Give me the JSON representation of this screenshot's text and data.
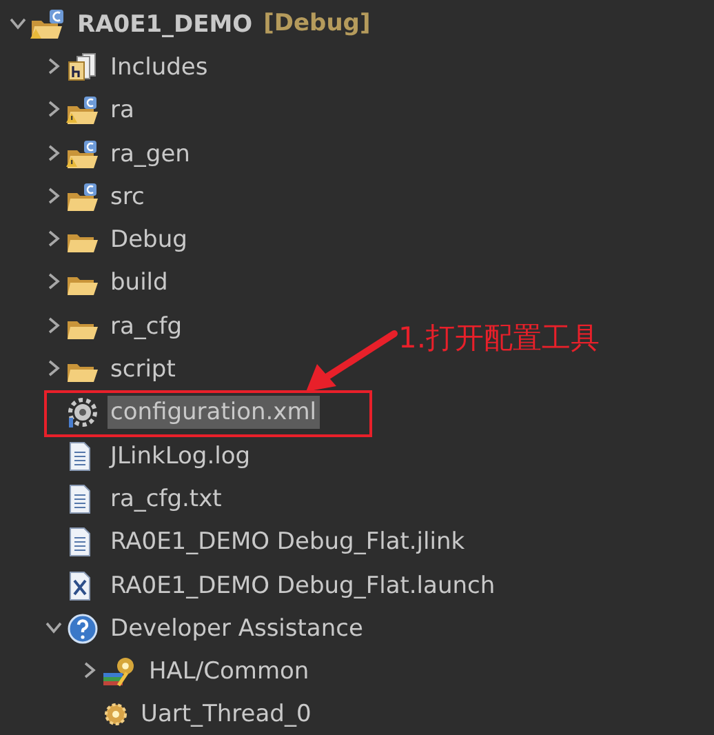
{
  "tree": [
    {
      "label": "RA0E1_DEMO",
      "tag": "[Debug]",
      "kind": "project",
      "expanded": true,
      "selected": false,
      "children": [
        {
          "label": "Includes",
          "kind": "includes",
          "expanded": false,
          "selected": false
        },
        {
          "label": "ra",
          "kind": "c-folder-warn",
          "expanded": false,
          "selected": false
        },
        {
          "label": "ra_gen",
          "kind": "c-folder-warn",
          "expanded": false,
          "selected": false
        },
        {
          "label": "src",
          "kind": "c-folder",
          "expanded": false,
          "selected": false
        },
        {
          "label": "Debug",
          "kind": "folder",
          "expanded": false,
          "selected": false
        },
        {
          "label": "build",
          "kind": "folder",
          "expanded": false,
          "selected": false
        },
        {
          "label": "ra_cfg",
          "kind": "folder",
          "expanded": false,
          "selected": false
        },
        {
          "label": "script",
          "kind": "folder",
          "expanded": false,
          "selected": false
        },
        {
          "label": "configuration.xml",
          "kind": "settings-file",
          "selected": true
        },
        {
          "label": "JLinkLog.log",
          "kind": "text-file",
          "selected": false
        },
        {
          "label": "ra_cfg.txt",
          "kind": "text-file",
          "selected": false
        },
        {
          "label": "RA0E1_DEMO Debug_Flat.jlink",
          "kind": "text-file",
          "selected": false
        },
        {
          "label": "RA0E1_DEMO Debug_Flat.launch",
          "kind": "xml-file",
          "selected": false
        },
        {
          "label": "Developer Assistance",
          "kind": "help",
          "expanded": true,
          "selected": false,
          "children": [
            {
              "label": "HAL/Common",
              "kind": "hal",
              "expanded": false,
              "selected": false
            },
            {
              "label": "Uart_Thread_0",
              "kind": "thread",
              "selected": false
            }
          ]
        }
      ]
    }
  ],
  "annotation": {
    "callout": "1.打开配置工具"
  }
}
